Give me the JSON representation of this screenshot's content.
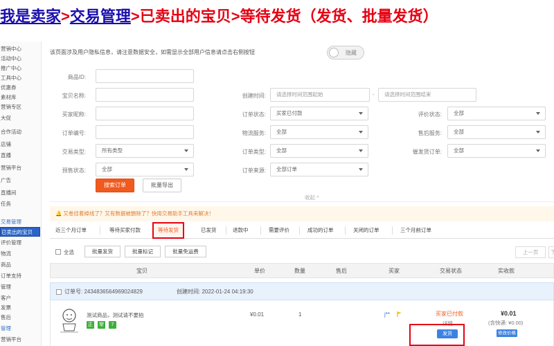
{
  "breadcrumb": {
    "seller": "我是卖家",
    "sep": ">",
    "trade": "交易管理",
    "rest": ">已卖出的宝贝>等待发货（发货、批量发货）"
  },
  "sidebar": {
    "items": [
      {
        "label": "营销中心"
      },
      {
        "label": "活动中心"
      },
      {
        "label": "推广中心"
      },
      {
        "label": "工具中心"
      },
      {
        "label": "优惠券"
      },
      {
        "label": "素材库"
      },
      {
        "label": "营销专区"
      },
      {
        "label": "大促"
      },
      {
        "label": "合作活动"
      },
      {
        "label": "店铺"
      },
      {
        "label": "直播"
      },
      {
        "label": "营销平台"
      },
      {
        "label": "广告"
      },
      {
        "label": "直播间"
      },
      {
        "label": "任务"
      },
      {
        "label": "交易管理"
      },
      {
        "label": "已卖出的宝贝"
      },
      {
        "label": "评价管理"
      },
      {
        "label": "物流"
      },
      {
        "label": "商品"
      },
      {
        "label": "订单支持"
      },
      {
        "label": "管理"
      },
      {
        "label": "客户"
      },
      {
        "label": "发票"
      },
      {
        "label": "售后"
      },
      {
        "label": "管理"
      },
      {
        "label": "营销平台"
      }
    ]
  },
  "privacy": {
    "notice": "该页面涉及用户隐私信息，请注意数据安全，如需显示全部用户信息请点击右侧按钮",
    "toggle_label": "隐藏"
  },
  "filters": {
    "product_id": {
      "label": "商品ID:"
    },
    "product_name": {
      "label": "宝贝名称:"
    },
    "buyer_nick": {
      "label": "买家昵称:"
    },
    "order_no": {
      "label": "订单编号:"
    },
    "trade_type": {
      "label": "交易类型:",
      "value": "所有类型"
    },
    "presale": {
      "label": "预售状态:",
      "value": "全部"
    },
    "created_time": {
      "label": "创建时间:",
      "start_placeholder": "请选择时间范围起始",
      "end_placeholder": "请选择时间范围结束",
      "dash": "-"
    },
    "order_status": {
      "label": "订单状态:",
      "value": "买家已付款"
    },
    "logistics": {
      "label": "物流服务:",
      "value": "全部"
    },
    "order_type": {
      "label": "订单类型:",
      "value": "全部"
    },
    "order_source": {
      "label": "订单来源:",
      "value": "全部订单"
    },
    "review_status": {
      "label": "评价状态:",
      "value": "全部"
    },
    "after_sale": {
      "label": "售后服务:",
      "value": "全部"
    },
    "delayed": {
      "label": "催发货订单:",
      "value": "全部"
    }
  },
  "actions": {
    "search": "搜索订单",
    "export": "批量导出",
    "collapse": "收起 ^"
  },
  "notice": "🔔 又卷挂着掉线了？又有数据被删除了？快用交易助手工具来解决！",
  "tabs": [
    {
      "label": "近三个月订单"
    },
    {
      "label": "等待买家付款"
    },
    {
      "label": "等待发货"
    },
    {
      "label": "已发货"
    },
    {
      "label": "退款中"
    },
    {
      "label": "需要评价"
    },
    {
      "label": "成功的订单"
    },
    {
      "label": "关闭的订单"
    },
    {
      "label": "三个月前订单"
    }
  ],
  "bulk": {
    "select_all": "全选",
    "ship": "批量发货",
    "mark": "批量标记",
    "free": "批量免运费",
    "prev": "上一页",
    "next": "下"
  },
  "table": {
    "headers": [
      "宝贝",
      "单价",
      "数量",
      "售后",
      "买家",
      "交易状态",
      "实收款"
    ]
  },
  "order": {
    "number": "订单号: 2434836564969024829",
    "created": "创建时间: 2022-01-24 04:19:30",
    "product": "测试商品，测试请不要拍",
    "tags": [
      "正",
      "常",
      "7"
    ],
    "price": "¥0.01",
    "qty": "1",
    "buyer": "j**",
    "status": "买家已付款",
    "detail": "详情",
    "ship_btn": "发货",
    "amount": "¥0.01",
    "shipping": "(含快递: ¥0.00)",
    "price_link": "修改价格"
  }
}
